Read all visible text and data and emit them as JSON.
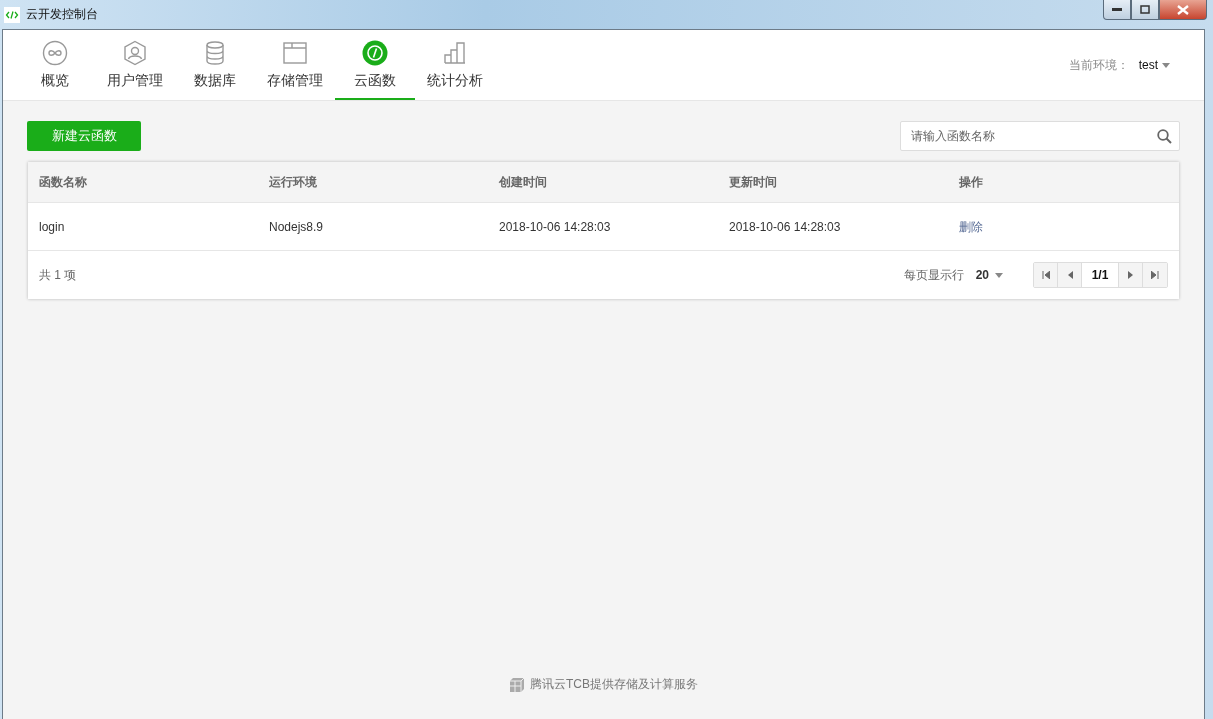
{
  "window": {
    "title": "云开发控制台"
  },
  "tabs": [
    {
      "label": "概览",
      "selected": false
    },
    {
      "label": "用户管理",
      "selected": false
    },
    {
      "label": "数据库",
      "selected": false
    },
    {
      "label": "存储管理",
      "selected": false
    },
    {
      "label": "云函数",
      "selected": true
    },
    {
      "label": "统计分析",
      "selected": false
    }
  ],
  "environment": {
    "label": "当前环境：",
    "value": "test"
  },
  "create_button": "新建云函数",
  "search": {
    "placeholder": "请输入函数名称"
  },
  "table": {
    "columns": [
      "函数名称",
      "运行环境",
      "创建时间",
      "更新时间",
      "操作"
    ],
    "rows": [
      {
        "name": "login",
        "runtime": "Nodejs8.9",
        "created": "2018-10-06 14:28:03",
        "updated": "2018-10-06 14:28:03",
        "action": "删除"
      }
    ]
  },
  "footer": {
    "total": "共 1 项",
    "page_size_label": "每页显示行",
    "page_size": "20",
    "page": "1/1"
  },
  "credit": "腾讯云TCB提供存储及计算服务"
}
